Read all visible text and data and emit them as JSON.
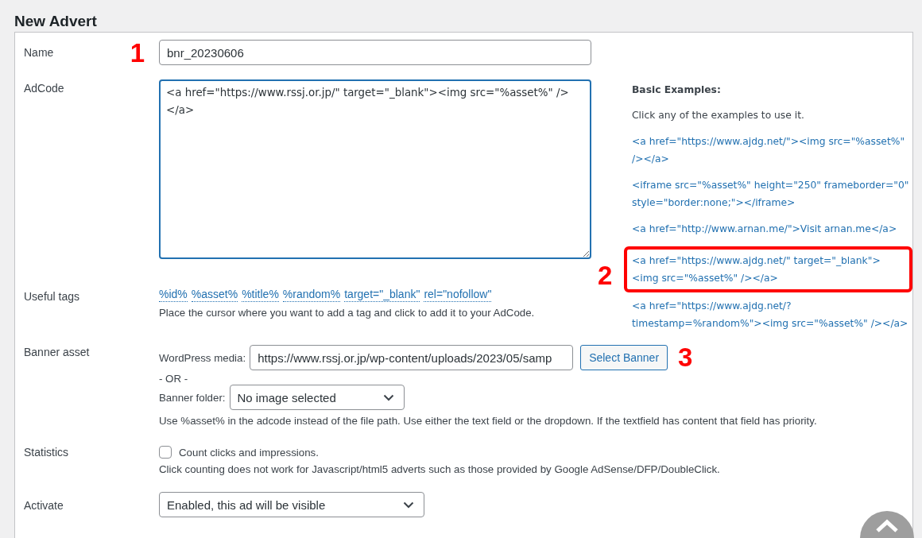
{
  "title": "New Advert",
  "name": {
    "label": "Name",
    "value": "bnr_20230606",
    "marker": "1"
  },
  "adcode": {
    "label": "AdCode",
    "value": "<a href=\"https://www.rssj.or.jp/\" target=\"_blank\"><img src=\"%asset%\" /></a>"
  },
  "examples": {
    "heading": "Basic Examples:",
    "hint": "Click any of the examples to use it.",
    "items": [
      {
        "code": "<a href=\"https://www.ajdg.net/\"><img src=\"%asset%\" /></a>"
      },
      {
        "code": "<iframe src=\"%asset%\" height=\"250\" frameborder=\"0\" style=\"border:none;\"></iframe>"
      },
      {
        "code": "<a href=\"http://www.arnan.me/\">Visit arnan.me</a>"
      },
      {
        "code": "<a href=\"https://www.ajdg.net/\" target=\"_blank\"><img src=\"%asset%\" /></a>",
        "annotation": {
          "marker": "2"
        }
      },
      {
        "code": "<a href=\"https://www.ajdg.net/?timestamp=%random%\"><img src=\"%asset%\" /></a>"
      }
    ]
  },
  "useful_tags": {
    "label": "Useful tags",
    "tags": [
      "%id%",
      "%asset%",
      "%title%",
      "%random%",
      "target=\"_blank\"",
      "rel=\"nofollow\""
    ],
    "hint": "Place the cursor where you want to add a tag and click to add it to your AdCode."
  },
  "banner_asset": {
    "label": "Banner asset",
    "media_label": "WordPress media:",
    "media_value": "https://www.rssj.or.jp/wp-content/uploads/2023/05/samp",
    "button": "Select Banner",
    "marker": "3",
    "or": "- OR -",
    "folder_label": "Banner folder:",
    "folder_value": "No image selected",
    "hint": "Use %asset% in the adcode instead of the file path. Use either the text field or the dropdown. If the textfield has content that field has priority."
  },
  "statistics": {
    "label": "Statistics",
    "checkbox_label": "Count clicks and impressions.",
    "checked": false,
    "hint": "Click counting does not work for Javascript/html5 adverts such as those provided by Google AdSense/DFP/DoubleClick."
  },
  "activate": {
    "label": "Activate",
    "value": "Enabled, this ad will be visible"
  }
}
